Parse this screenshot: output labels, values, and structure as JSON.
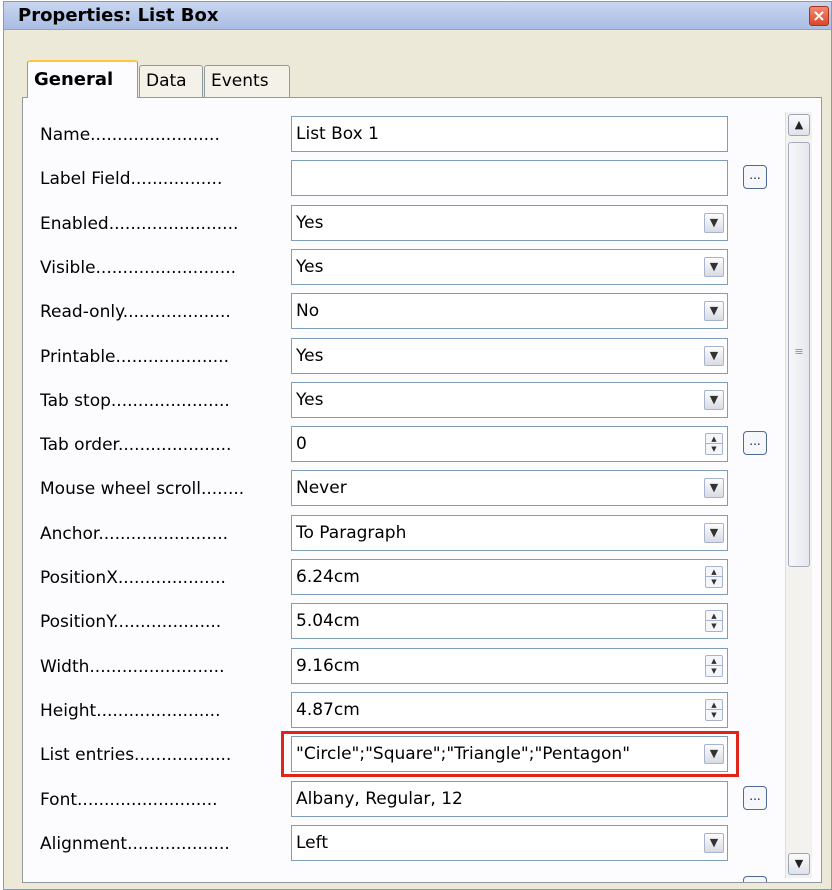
{
  "window": {
    "title": "Properties: List Box",
    "close_symbol": "×"
  },
  "tabs": [
    {
      "label": "General"
    },
    {
      "label": "Data"
    },
    {
      "label": "Events"
    }
  ],
  "properties": [
    {
      "label": "Name........................",
      "value": "List Box 1",
      "type": "text"
    },
    {
      "label": "Label Field.................",
      "value": "",
      "type": "text",
      "ellipsis": "..."
    },
    {
      "label": "Enabled........................",
      "value": "Yes",
      "type": "dropdown"
    },
    {
      "label": "Visible..........................",
      "value": "Yes",
      "type": "dropdown"
    },
    {
      "label": "Read-only....................",
      "value": "No",
      "type": "dropdown"
    },
    {
      "label": "Printable.....................",
      "value": "Yes",
      "type": "dropdown"
    },
    {
      "label": "Tab stop......................",
      "value": "Yes",
      "type": "dropdown"
    },
    {
      "label": "Tab order.....................",
      "value": "0",
      "type": "spin",
      "ellipsis": "..."
    },
    {
      "label": "Mouse wheel scroll........",
      "value": "Never",
      "type": "dropdown"
    },
    {
      "label": "Anchor........................",
      "value": "To Paragraph",
      "type": "dropdown"
    },
    {
      "label": "PositionX....................",
      "value": "6.24cm",
      "type": "spin"
    },
    {
      "label": "PositionY....................",
      "value": "5.04cm",
      "type": "spin"
    },
    {
      "label": "Width.........................",
      "value": "9.16cm",
      "type": "spin"
    },
    {
      "label": "Height.......................",
      "value": "4.87cm",
      "type": "spin"
    },
    {
      "label": "List entries..................",
      "value": "\"Circle\";\"Square\";\"Triangle\";\"Pentagon\"",
      "type": "dropdown"
    },
    {
      "label": "Font..........................",
      "value": "Albany, Regular, 12",
      "type": "text",
      "ellipsis": "..."
    },
    {
      "label": "Alignment...................",
      "value": "Left",
      "type": "dropdown"
    }
  ],
  "icons": {
    "dropdown": "chevron-down-icon",
    "spin": "spin-arrows-icon",
    "ellipsis": "ellipsis-button-icon",
    "scroll_up": "scroll-up-icon",
    "scroll_down": "scroll-down-icon",
    "close": "close-icon"
  },
  "colors": {
    "highlight": "#e0241a",
    "title_bar": "#b9c9e9"
  }
}
